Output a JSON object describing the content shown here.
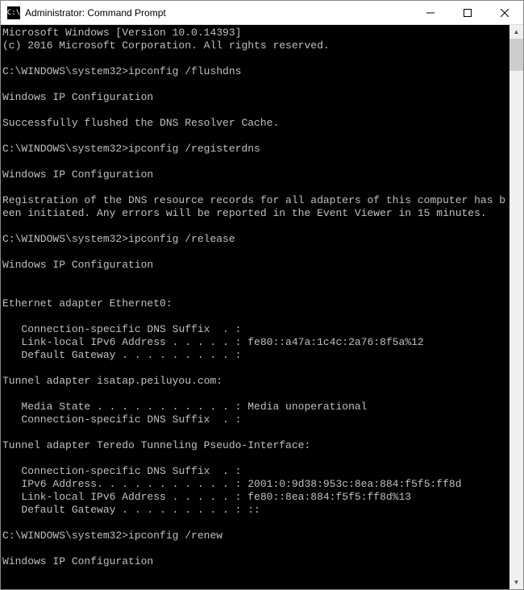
{
  "titlebar": {
    "icon_text": "C:\\",
    "title": "Administrator: Command Prompt"
  },
  "console": {
    "lines": [
      "Microsoft Windows [Version 10.0.14393]",
      "(c) 2016 Microsoft Corporation. All rights reserved.",
      "",
      "C:\\WINDOWS\\system32>ipconfig /flushdns",
      "",
      "Windows IP Configuration",
      "",
      "Successfully flushed the DNS Resolver Cache.",
      "",
      "C:\\WINDOWS\\system32>ipconfig /registerdns",
      "",
      "Windows IP Configuration",
      "",
      "Registration of the DNS resource records for all adapters of this computer has been initiated. Any errors will be reported in the Event Viewer in 15 minutes.",
      "",
      "C:\\WINDOWS\\system32>ipconfig /release",
      "",
      "Windows IP Configuration",
      "",
      "",
      "Ethernet adapter Ethernet0:",
      "",
      "   Connection-specific DNS Suffix  . :",
      "   Link-local IPv6 Address . . . . . : fe80::a47a:1c4c:2a76:8f5a%12",
      "   Default Gateway . . . . . . . . . :",
      "",
      "Tunnel adapter isatap.peiluyou.com:",
      "",
      "   Media State . . . . . . . . . . . : Media unoperational",
      "   Connection-specific DNS Suffix  . :",
      "",
      "Tunnel adapter Teredo Tunneling Pseudo-Interface:",
      "",
      "   Connection-specific DNS Suffix  . :",
      "   IPv6 Address. . . . . . . . . . . : 2001:0:9d38:953c:8ea:884:f5f5:ff8d",
      "   Link-local IPv6 Address . . . . . : fe80::8ea:884:f5f5:ff8d%13",
      "   Default Gateway . . . . . . . . . : ::",
      "",
      "C:\\WINDOWS\\system32>ipconfig /renew",
      "",
      "Windows IP Configuration"
    ]
  }
}
